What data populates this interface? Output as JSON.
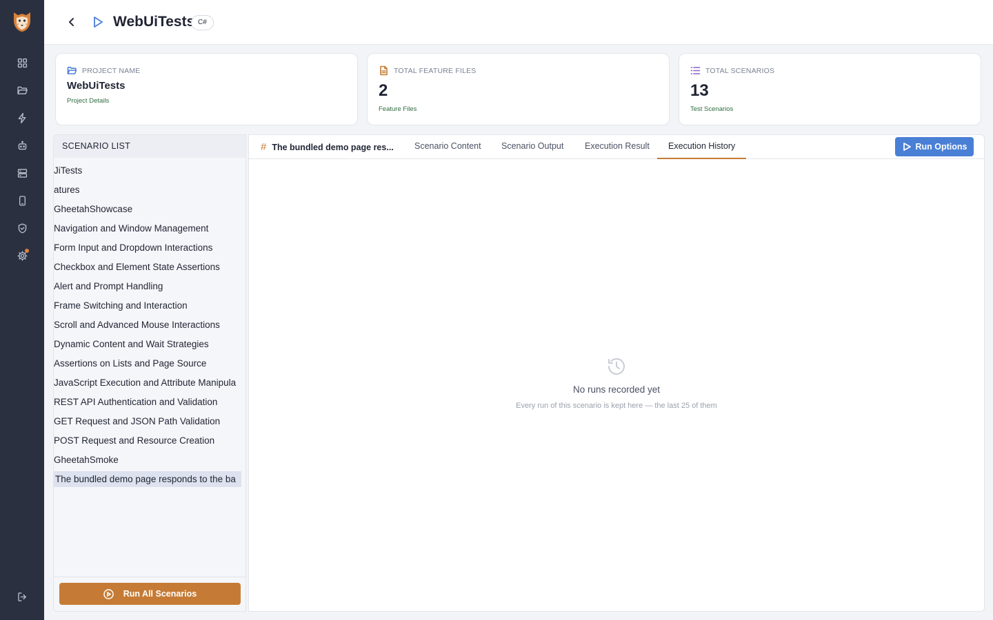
{
  "sidebar": {
    "icons": [
      "dashboard-icon",
      "folder-icon",
      "lightning-icon",
      "robot-icon",
      "server-icon",
      "mobile-icon",
      "shield-icon",
      "settings-icon",
      "logout-icon"
    ]
  },
  "header": {
    "title": "WebUiTests",
    "badge": "C#"
  },
  "cards": [
    {
      "label": "PROJECT NAME",
      "value": "WebUiTests",
      "sub": "Project Details"
    },
    {
      "label": "TOTAL FEATURE FILES",
      "value": "2",
      "sub": "Feature Files"
    },
    {
      "label": "TOTAL SCENARIOS",
      "value": "13",
      "sub": "Test Scenarios"
    }
  ],
  "scenario_list": {
    "header": "SCENARIO LIST",
    "items": [
      "JiTests",
      "atures",
      "GheetahShowcase",
      "Navigation and Window Management",
      "Form Input and Dropdown Interactions",
      "Checkbox and Element State Assertions",
      "Alert and Prompt Handling",
      "Frame Switching and Interaction",
      "Scroll and Advanced Mouse Interactions",
      "Dynamic Content and Wait Strategies",
      "Assertions on Lists and Page Source",
      "JavaScript Execution and Attribute Manipula",
      "REST API Authentication and Validation",
      "GET Request and JSON Path Validation",
      "POST Request and Resource Creation",
      "GheetahSmoke",
      "The bundled demo page responds to the ba"
    ],
    "selected_index": 16,
    "run_all_label": "Run All Scenarios"
  },
  "main": {
    "scenario_tab_label": "The bundled demo page res...",
    "tabs": [
      "Scenario Content",
      "Scenario Output",
      "Execution Result",
      "Execution History"
    ],
    "active_tab": "Execution History",
    "run_options_label": "Run Options",
    "empty_title": "No runs recorded yet",
    "empty_subtitle": "Every run of this scenario is kept here — the last 25 of them"
  },
  "colors": {
    "sidebar_bg": "#2b3040",
    "accent_orange": "#c57b35",
    "accent_blue": "#4a7fd6"
  }
}
